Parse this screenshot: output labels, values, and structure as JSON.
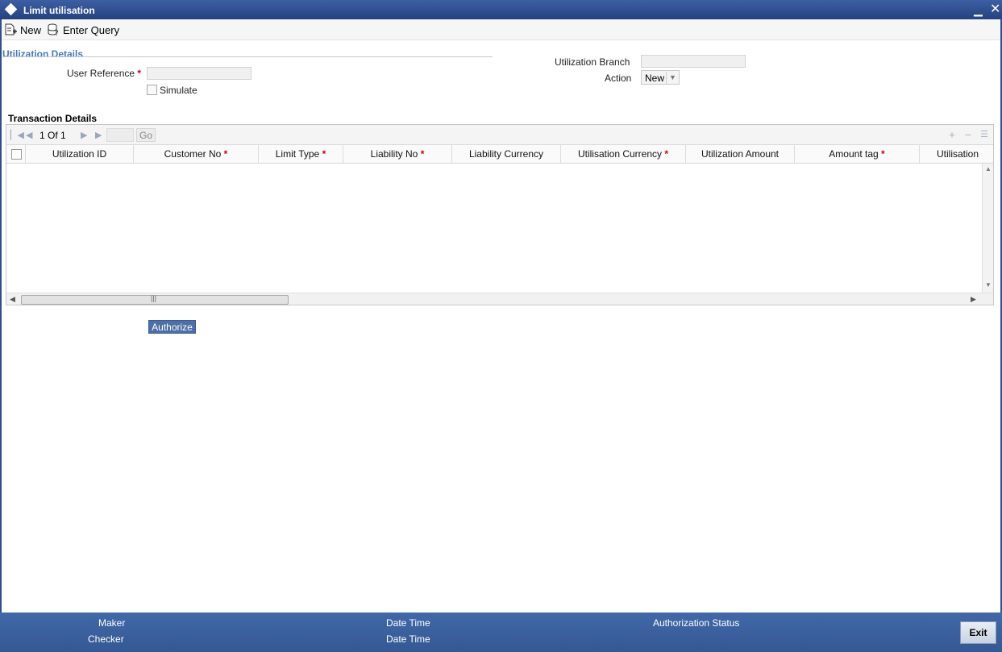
{
  "window": {
    "title": "Limit utilisation",
    "minimize_icon": "minimize-icon",
    "close_icon": "close-icon"
  },
  "toolbar": {
    "new_label": "New",
    "enter_query_label": "Enter Query"
  },
  "utilization_details": {
    "section_title": "Utilization Details",
    "user_reference_label": "User Reference",
    "user_reference_value": "",
    "simulate_label": "Simulate",
    "simulate_checked": false,
    "utilization_branch_label": "Utilization Branch",
    "utilization_branch_value": "",
    "action_label": "Action",
    "action_value": "New"
  },
  "transaction_details": {
    "section_title": "Transaction Details",
    "pagination": {
      "current": "1",
      "of_label": "Of",
      "total": "1",
      "go_label": "Go"
    },
    "columns": [
      {
        "label": "Utilization ID",
        "required": false
      },
      {
        "label": "Customer No",
        "required": true
      },
      {
        "label": "Limit Type",
        "required": true
      },
      {
        "label": "Liability No",
        "required": true
      },
      {
        "label": "Liability Currency",
        "required": false
      },
      {
        "label": "Utilisation Currency",
        "required": true
      },
      {
        "label": "Utilization Amount",
        "required": false
      },
      {
        "label": "Amount tag",
        "required": true
      },
      {
        "label": "Utilisation",
        "required": false
      }
    ],
    "rows": []
  },
  "actions": {
    "authorize_label": "Authorize",
    "exit_label": "Exit"
  },
  "footer": {
    "maker_label": "Maker",
    "checker_label": "Checker",
    "date_time_label_1": "Date Time",
    "date_time_label_2": "Date Time",
    "authorization_status_label": "Authorization Status"
  },
  "required_marker": "*",
  "colors": {
    "titlebar": "#2f4f8f",
    "section_title": "#4b78b8",
    "required": "#d40000",
    "footer": "#3a5f9d",
    "authorize_button": "#4d6fa8"
  }
}
